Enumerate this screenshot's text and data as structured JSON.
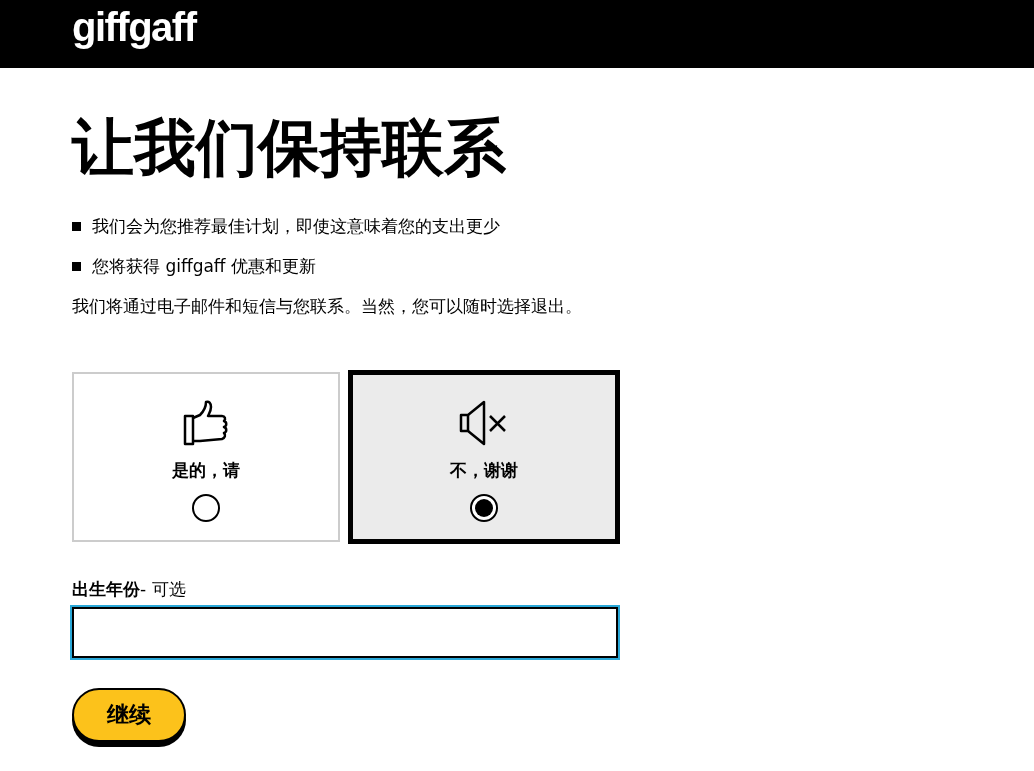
{
  "header": {
    "logo": "giffgaff"
  },
  "heading": "让我们保持联系",
  "bullets": [
    "我们会为您推荐最佳计划，即使这意味着您的支出更少",
    "您将获得 giffgaff 优惠和更新"
  ],
  "note": "我们将通过电子邮件和短信与您联系。当然，您可以随时选择退出。",
  "options": [
    {
      "kind": "thumbs-up",
      "label": "是的，请",
      "selected": false
    },
    {
      "kind": "mute",
      "label": "不，谢谢",
      "selected": true
    }
  ],
  "birth_year": {
    "label": "**出生年份**- 可选"
  },
  "continue_button": "继续"
}
